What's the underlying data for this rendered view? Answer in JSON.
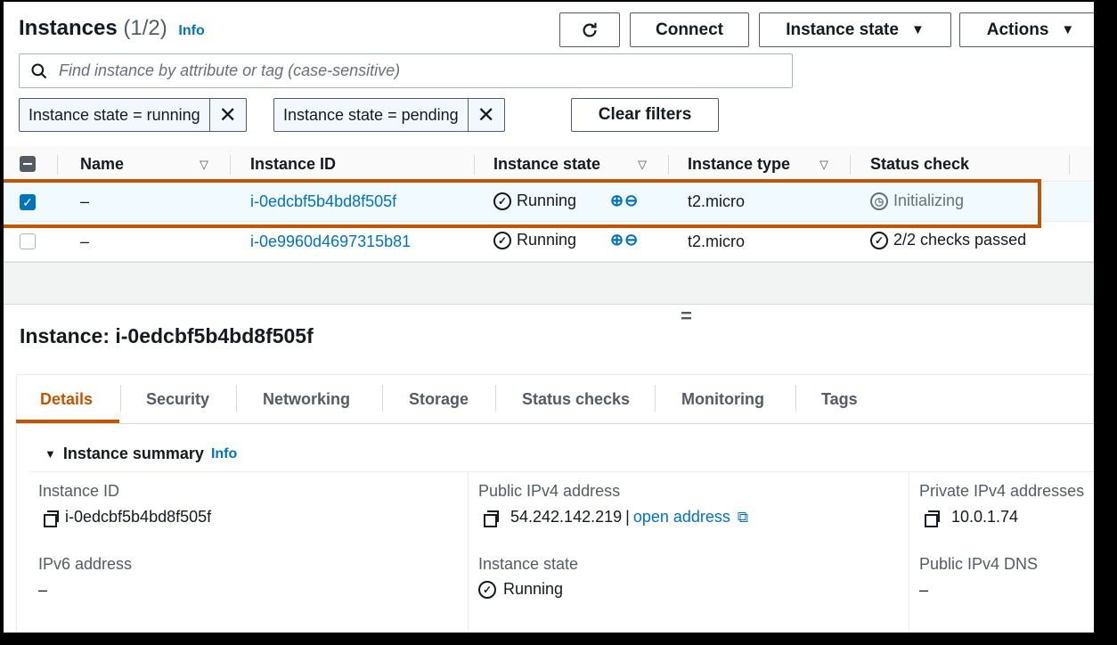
{
  "header": {
    "title": "Instances",
    "count": "(1/2)",
    "info": "Info",
    "refresh_icon": "refresh-icon",
    "connect": "Connect",
    "instance_state": "Instance state",
    "actions": "Actions"
  },
  "search": {
    "placeholder": "Find instance by attribute or tag (case-sensitive)"
  },
  "filters": {
    "tokens": [
      "Instance state = running",
      "Instance state = pending"
    ],
    "clear": "Clear filters"
  },
  "table": {
    "columns": [
      "Name",
      "Instance ID",
      "Instance state",
      "Instance type",
      "Status check"
    ],
    "rows": [
      {
        "selected": true,
        "name": "–",
        "id": "i-0edcbf5b4bd8f505f",
        "state": "Running",
        "type": "t2.micro",
        "status": "Initializing"
      },
      {
        "selected": false,
        "name": "–",
        "id": "i-0e9960d4697315b81",
        "state": "Running",
        "type": "t2.micro",
        "status": "2/2 checks passed"
      }
    ]
  },
  "panel": {
    "title": "Instance: i-0edcbf5b4bd8f505f",
    "tabs": [
      "Details",
      "Security",
      "Networking",
      "Storage",
      "Status checks",
      "Monitoring",
      "Tags"
    ],
    "active_tab": "Details",
    "summary_title": "Instance summary",
    "summary_info": "Info",
    "fields": {
      "instance_id_label": "Instance ID",
      "instance_id": "i-0edcbf5b4bd8f505f",
      "public_ipv4_label": "Public IPv4 address",
      "public_ipv4": "54.242.142.219",
      "open_address": "open address",
      "private_ipv4_label": "Private IPv4 addresses",
      "private_ipv4": "10.0.1.74",
      "ipv6_label": "IPv6 address",
      "ipv6": "–",
      "state_label": "Instance state",
      "state": "Running",
      "public_dns_label": "Public IPv4 DNS",
      "public_dns": "–"
    }
  },
  "colors": {
    "accent": "#c45500",
    "link": "#0073bb",
    "text": "#16191f"
  }
}
